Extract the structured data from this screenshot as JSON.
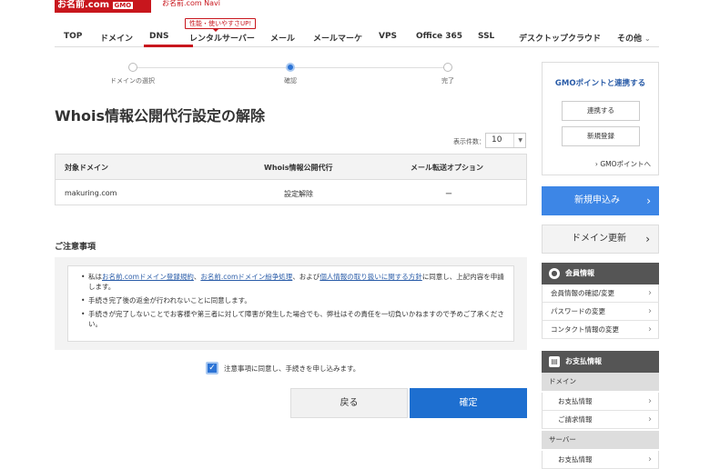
{
  "header": {
    "logo_text": "お名前.com",
    "logo_sub": "GMO",
    "tagline": "お名前.com Navi"
  },
  "nav": {
    "items": [
      {
        "label": "TOP"
      },
      {
        "label": "ドメイン"
      },
      {
        "label": "DNS"
      },
      {
        "label": "レンタルサーバー"
      },
      {
        "label": "メール"
      },
      {
        "label": "メールマーケ"
      },
      {
        "label": "VPS"
      },
      {
        "label": "Office 365"
      },
      {
        "label": "SSL"
      },
      {
        "label": "デスクトップクラウド"
      },
      {
        "label": "その他"
      }
    ],
    "badge": "性能・使いやすさUP!"
  },
  "steps": {
    "items": [
      {
        "label": "ドメインの選択"
      },
      {
        "label": "確認"
      },
      {
        "label": "完了"
      }
    ]
  },
  "main": {
    "title": "Whois情報公開代行設定の解除",
    "count_label": "表示件数：",
    "count_value": "10",
    "table": {
      "headers": [
        "対象ドメイン",
        "Whois情報公開代行",
        "メール転送オプション"
      ],
      "row": [
        "makuring.com",
        "設定解除",
        "ー"
      ]
    },
    "notes_title": "ご注意事項",
    "notes": {
      "n1_pre": "私は",
      "n1_link1": "お名前.comドメイン登録規約",
      "n1_sep": "、",
      "n1_link2": "お名前.comドメイン紛争処理",
      "n1_mid": "、および",
      "n1_link3": "個人情報の取り扱いに関する方針",
      "n1_post": "に同意し、上記内容を申請します。",
      "n2": "手続き完了後の返金が行われないことに同意します。",
      "n3": "手続きが完了しないことでお客様や第三者に対して障害が発生した場合でも、弊社はその責任を一切負いかねますので予めご了承ください。"
    },
    "agree_label": "注意事項に同意し、手続きを申し込みます。",
    "back_button": "戻る",
    "confirm_button": "確定"
  },
  "sidebar": {
    "gmo_title": "GMOポイントと連携する",
    "gmo_link_button": "連携する",
    "gmo_register_button": "新規登録",
    "gmo_points_link": "GMOポイントへ",
    "new_application": "新規申込み",
    "domain_renewal": "ドメイン更新",
    "member_header": "会員情報",
    "member_items": [
      {
        "label": "会員情報の確認/変更"
      },
      {
        "label": "パスワードの変更"
      },
      {
        "label": "コンタクト情報の変更"
      }
    ],
    "payment_header": "お支払情報",
    "payment_domain": "ドメイン",
    "payment_domain_items": [
      {
        "label": "お支払情報"
      },
      {
        "label": "ご請求情報"
      }
    ],
    "payment_server": "サーバー",
    "payment_server_items": [
      {
        "label": "お支払情報"
      }
    ]
  },
  "colors": {
    "brand_red": "#c8161d",
    "primary_blue": "#1e6fd0",
    "link_blue": "#2a5ca8"
  },
  "icons": {
    "checkbox": "check-icon",
    "arrow": "chevron-right-icon",
    "member": "user-icon",
    "payment": "wallet-icon"
  }
}
